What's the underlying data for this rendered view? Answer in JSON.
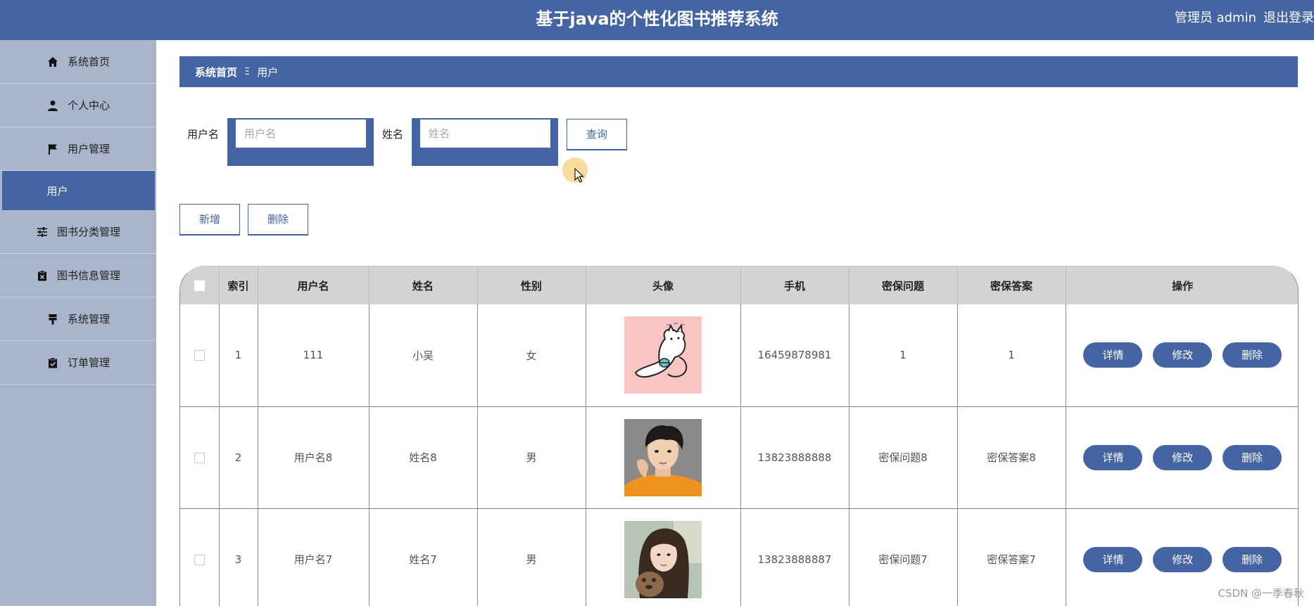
{
  "header": {
    "title": "基于java的个性化图书推荐系统",
    "role": "管理员 admin",
    "logout": "退出登录",
    "bg_color": "#4464a4"
  },
  "sidebar": {
    "items": [
      {
        "label": "系统首页",
        "icon": "home-icon"
      },
      {
        "label": "个人中心",
        "icon": "person-icon"
      },
      {
        "label": "用户管理",
        "icon": "flag-icon"
      },
      {
        "label": "用户",
        "icon": ""
      },
      {
        "label": "图书分类管理",
        "icon": "sliders-icon"
      },
      {
        "label": "图书信息管理",
        "icon": "clipboard-x-icon"
      },
      {
        "label": "系统管理",
        "icon": "pin-icon"
      },
      {
        "label": "订单管理",
        "icon": "clipboard-check-icon"
      }
    ]
  },
  "breadcrumb": {
    "home": "系统首页",
    "separator": "Ξ",
    "current": "用户"
  },
  "search": {
    "username_label": "用户名",
    "username_placeholder": "用户名",
    "name_label": "姓名",
    "name_placeholder": "姓名",
    "query_button": "查询"
  },
  "actions": {
    "add_button": "新增",
    "delete_button": "删除"
  },
  "table": {
    "columns": [
      "",
      "索引",
      "用户名",
      "姓名",
      "性别",
      "头像",
      "手机",
      "密保问题",
      "密保答案",
      "操作"
    ],
    "rows": [
      {
        "index": "1",
        "username": "111",
        "name": "小吴",
        "gender": "女",
        "avatar": "cartoon-cat-avatar",
        "phone": "16459878981",
        "question": "1",
        "answer": "1"
      },
      {
        "index": "2",
        "username": "用户名8",
        "name": "姓名8",
        "gender": "男",
        "avatar": "boy-photo-avatar",
        "phone": "13823888888",
        "question": "密保问题8",
        "answer": "密保答案8"
      },
      {
        "index": "3",
        "username": "用户名7",
        "name": "姓名7",
        "gender": "男",
        "avatar": "girl-photo-avatar",
        "phone": "13823888887",
        "question": "密保问题7",
        "answer": "密保答案7"
      }
    ],
    "row_actions": {
      "detail": "详情",
      "edit": "修改",
      "delete": "删除"
    }
  },
  "watermark": "CSDN @一季春秋"
}
